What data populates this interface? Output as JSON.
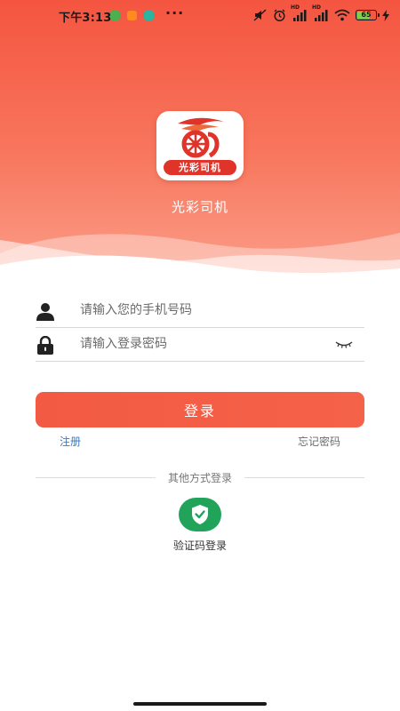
{
  "status_bar": {
    "time": "下午3:13",
    "more_indicator": "···",
    "battery_level": "65",
    "network_label_1": "HD",
    "network_label_2": "HD"
  },
  "brand": {
    "logo_text": "光彩司机",
    "app_name": "光彩司机",
    "accent_color": "#f35a43"
  },
  "login_form": {
    "phone_placeholder": "请输入您的手机号码",
    "password_placeholder": "请输入登录密码",
    "submit_label": "登录",
    "register_label": "注册",
    "forgot_password_label": "忘记密码"
  },
  "other_login": {
    "divider_label": "其他方式登录",
    "sms_login_label": "验证码登录",
    "sms_icon": "shield-check-icon",
    "icon_color": "#22a35a"
  }
}
